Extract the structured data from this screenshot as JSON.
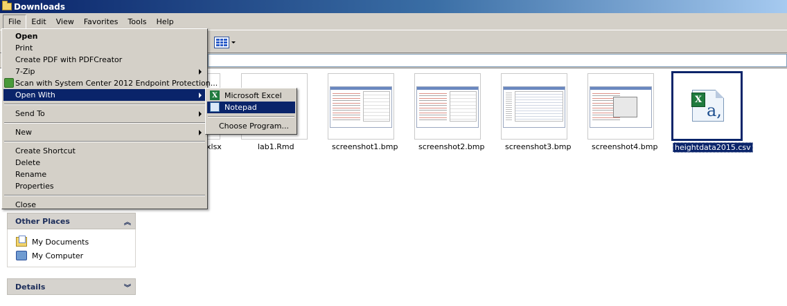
{
  "window": {
    "title": "Downloads"
  },
  "menubar": [
    "File",
    "Edit",
    "View",
    "Favorites",
    "Tools",
    "Help"
  ],
  "file_menu": {
    "items": [
      {
        "label": "Open",
        "bold": true
      },
      {
        "label": "Print"
      },
      {
        "label": "Create PDF with PDFCreator"
      },
      {
        "label": "7-Zip",
        "submenu": true
      },
      {
        "label": "Scan with System Center 2012 Endpoint Protection...",
        "icon": "shield-scan-icon"
      },
      {
        "label": "Open With",
        "submenu": true,
        "highlighted": true
      },
      {
        "separator": true
      },
      {
        "label": "Send To",
        "submenu": true
      },
      {
        "separator": true
      },
      {
        "label": "New",
        "submenu": true
      },
      {
        "separator": true
      },
      {
        "label": "Create Shortcut"
      },
      {
        "label": "Delete"
      },
      {
        "label": "Rename"
      },
      {
        "label": "Properties"
      },
      {
        "separator": true
      },
      {
        "label": "Close"
      }
    ]
  },
  "open_with_menu": {
    "items": [
      {
        "label": "Microsoft Excel",
        "icon": "excel-icon"
      },
      {
        "label": "Notepad",
        "icon": "notepad-icon",
        "highlighted": true
      },
      {
        "separator": true
      },
      {
        "label": "Choose Program..."
      }
    ]
  },
  "other_places": {
    "title": "Other Places",
    "links": [
      {
        "label": "My Documents",
        "icon": "my-documents-icon"
      },
      {
        "label": "My Computer",
        "icon": "my-computer-icon"
      }
    ]
  },
  "details": {
    "title": "Details"
  },
  "files": [
    {
      "name": "xlsx"
    },
    {
      "name": "lab1.Rmd"
    },
    {
      "name": "screenshot1.bmp"
    },
    {
      "name": "screenshot2.bmp"
    },
    {
      "name": "screenshot3.bmp"
    },
    {
      "name": "screenshot4.bmp"
    },
    {
      "name": "heightdata2015.csv",
      "selected": true
    }
  ],
  "colors": {
    "selection": "#0a246a",
    "menu_bg": "#d4d0c8"
  }
}
